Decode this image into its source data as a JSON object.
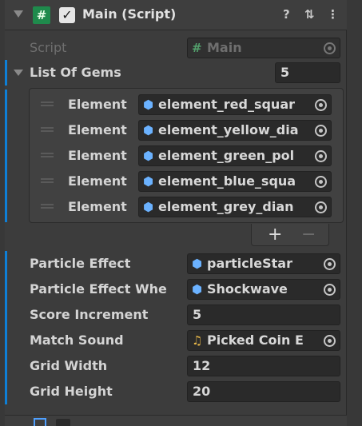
{
  "component": {
    "title": "Main (Script)",
    "enabled_check": "✓",
    "script_icon_glyph": "#",
    "help_icon": "?",
    "presets_icon": "⇅",
    "menu_icon": "⋮"
  },
  "script_field": {
    "label": "Script",
    "value": "Main"
  },
  "gems": {
    "label": "List Of Gems",
    "size": "5",
    "element_label": "Element",
    "items": [
      {
        "value": "element_red_squar"
      },
      {
        "value": "element_yellow_dia"
      },
      {
        "value": "element_green_pol"
      },
      {
        "value": "element_blue_squa"
      },
      {
        "value": "element_grey_dian"
      }
    ],
    "add_label": "+",
    "remove_label": "−"
  },
  "properties": {
    "particle_effect": {
      "label": "Particle Effect",
      "value": "particleStar"
    },
    "particle_effect_when": {
      "label": "Particle Effect Whe",
      "value": "Shockwave"
    },
    "score_increment": {
      "label": "Score Increment",
      "value": "5"
    },
    "match_sound": {
      "label": "Match Sound",
      "value": "Picked Coin E"
    },
    "grid_width": {
      "label": "Grid Width",
      "value": "12"
    },
    "grid_height": {
      "label": "Grid Height",
      "value": "20"
    }
  },
  "colors": {
    "accent_modified": "#0e7fd6",
    "script_icon_bg": "#1f8a4c",
    "prefab_icon": "#6bb2ff",
    "audio_icon": "#e9b949"
  }
}
